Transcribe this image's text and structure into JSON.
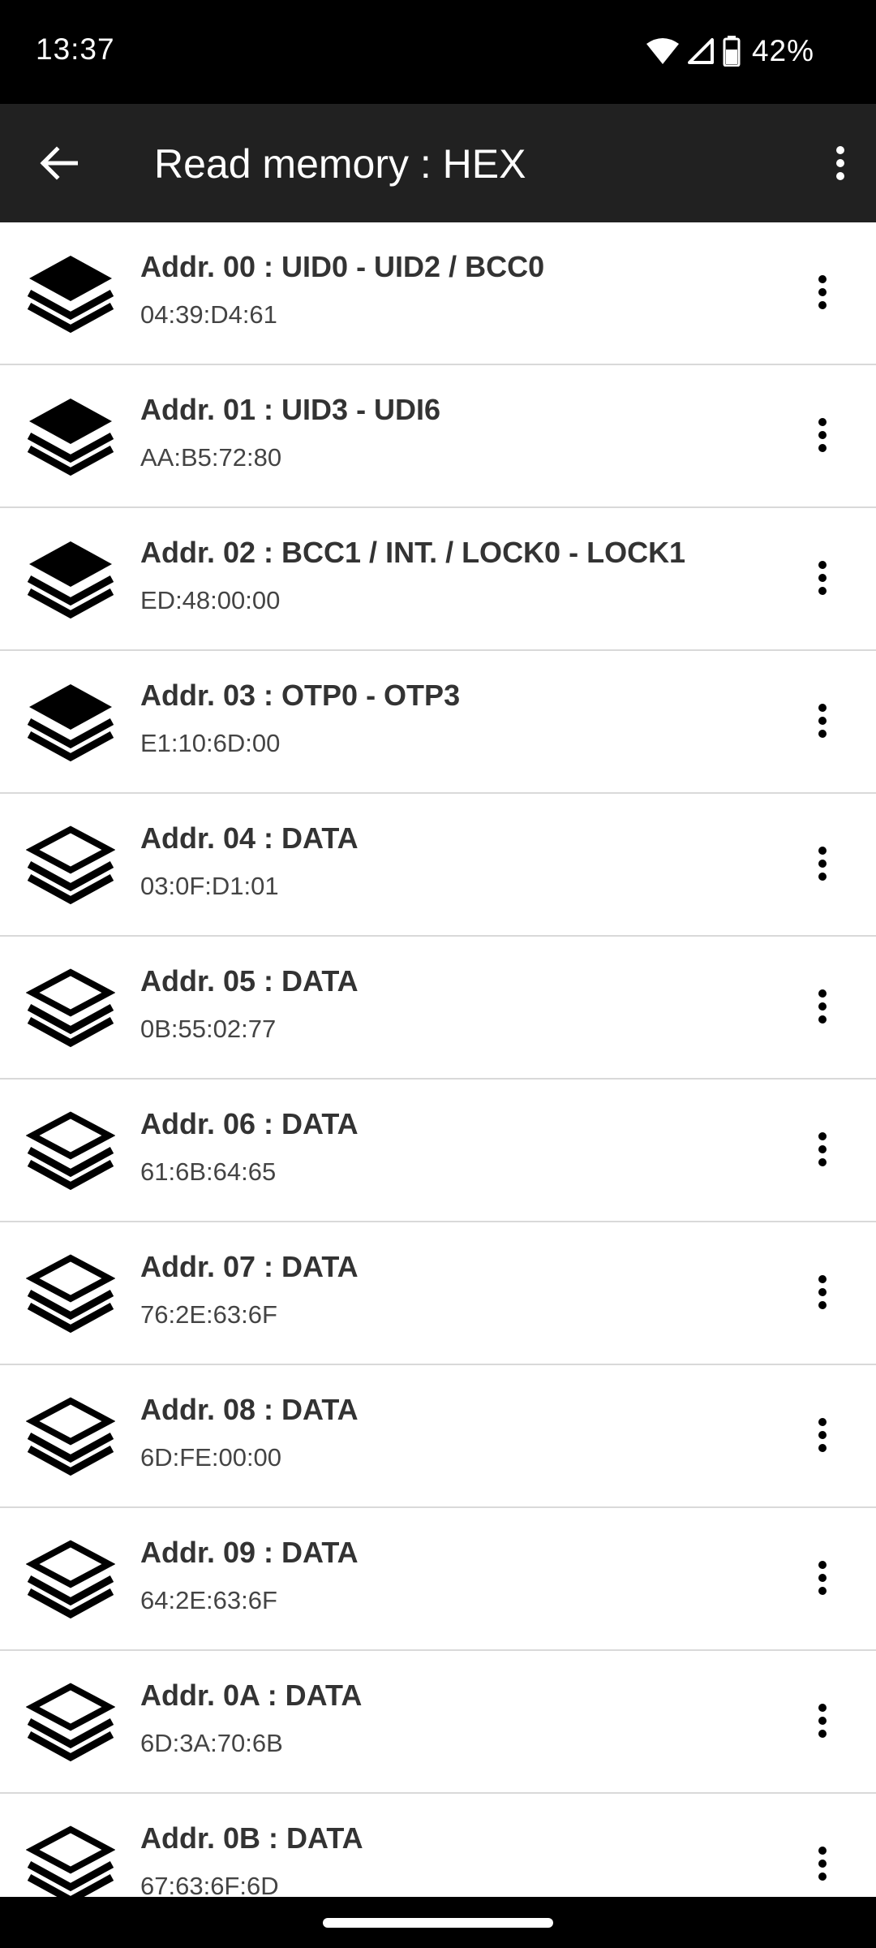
{
  "status_bar": {
    "time": "13:37",
    "battery_percent": "42%",
    "icons": [
      "wifi-icon",
      "cellular-signal-icon",
      "battery-icon"
    ]
  },
  "app_bar": {
    "title": "Read memory : HEX",
    "back_icon": "arrow-back-icon",
    "menu_icon": "more-vert-icon"
  },
  "colors": {
    "app_bar_bg": "#212121",
    "status_bar_bg": "#000000",
    "divider": "#d9d9d9"
  },
  "rows": [
    {
      "title": "Addr. 00 : UID0 - UID2 / BCC0",
      "value": "04:39:D4:61",
      "icon": "layers-filled-icon"
    },
    {
      "title": "Addr. 01 : UID3 - UDI6",
      "value": "AA:B5:72:80",
      "icon": "layers-filled-icon"
    },
    {
      "title": "Addr. 02 : BCC1 / INT. / LOCK0 - LOCK1",
      "value": "ED:48:00:00",
      "icon": "layers-filled-icon"
    },
    {
      "title": "Addr. 03 : OTP0 - OTP3",
      "value": "E1:10:6D:00",
      "icon": "layers-filled-icon"
    },
    {
      "title": "Addr. 04 : DATA",
      "value": "03:0F:D1:01",
      "icon": "layers-outline-icon"
    },
    {
      "title": "Addr. 05 : DATA",
      "value": "0B:55:02:77",
      "icon": "layers-outline-icon"
    },
    {
      "title": "Addr. 06 : DATA",
      "value": "61:6B:64:65",
      "icon": "layers-outline-icon"
    },
    {
      "title": "Addr. 07 : DATA",
      "value": "76:2E:63:6F",
      "icon": "layers-outline-icon"
    },
    {
      "title": "Addr. 08 : DATA",
      "value": "6D:FE:00:00",
      "icon": "layers-outline-icon"
    },
    {
      "title": "Addr. 09 : DATA",
      "value": "64:2E:63:6F",
      "icon": "layers-outline-icon"
    },
    {
      "title": "Addr. 0A : DATA",
      "value": "6D:3A:70:6B",
      "icon": "layers-outline-icon"
    },
    {
      "title": "Addr. 0B : DATA",
      "value": "67:63:6F:6D",
      "icon": "layers-outline-icon"
    }
  ]
}
